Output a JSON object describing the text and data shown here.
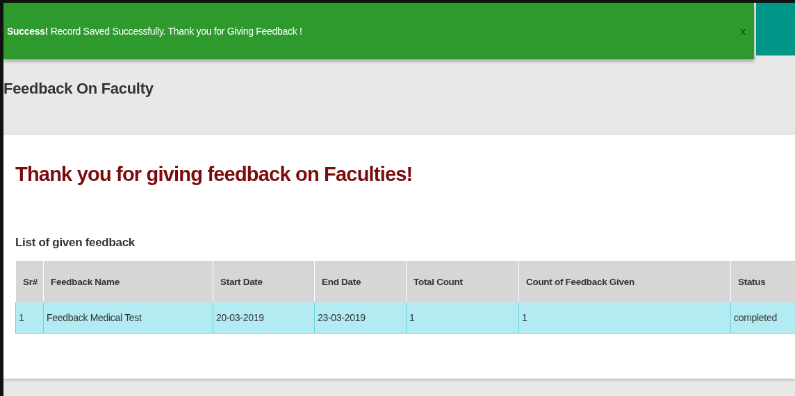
{
  "alert": {
    "message": "**Success!** Record Saved Successfully. Thank you for Giving Feedback !",
    "close": "x"
  },
  "page_header": {
    "title": "Feedback On Faculty"
  },
  "card": {
    "heading": "Thank you for giving feedback on Faculties!",
    "subheading": "List of given feedback"
  },
  "table": {
    "columns": [
      "Sr#",
      "Feedback Name",
      "Start Date",
      "End Date",
      "Total Count",
      "Count of Feedback Given",
      "Status"
    ],
    "rows": [
      [
        "1",
        "Feedback Medical Test",
        "20-03-2019",
        "23-03-2019",
        "1",
        "1",
        "completed"
      ]
    ]
  }
}
